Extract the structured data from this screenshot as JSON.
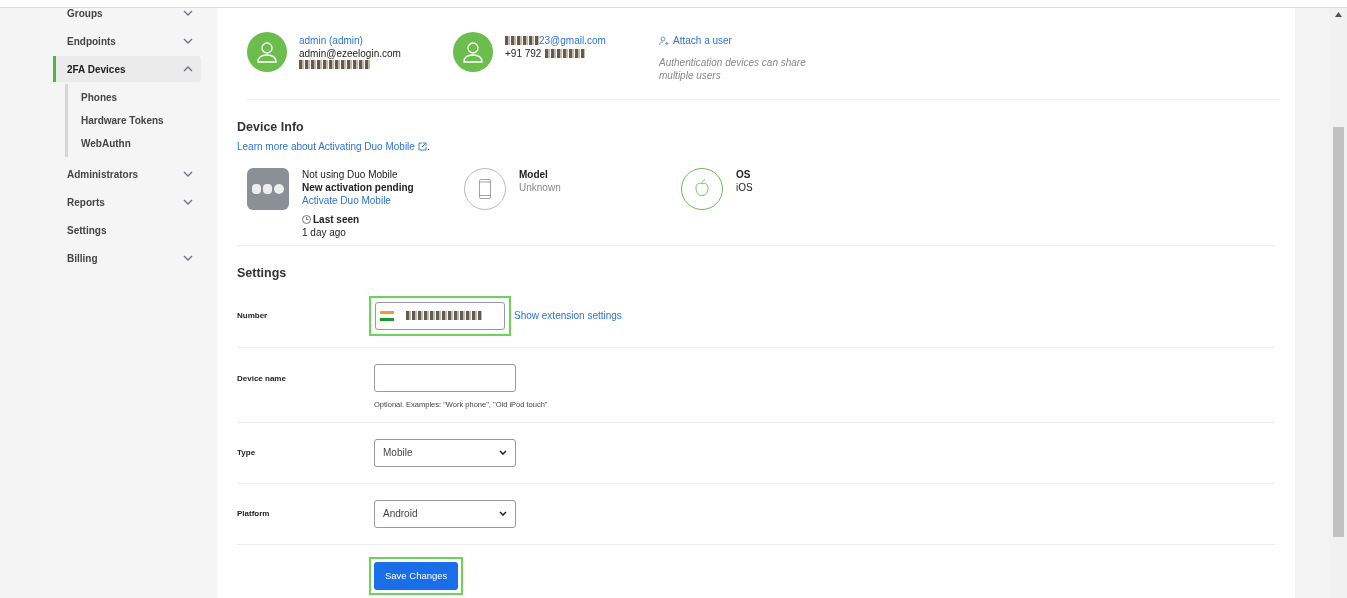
{
  "sidebar": {
    "items": [
      {
        "label": "Groups",
        "expandable": true,
        "expanded": false,
        "selected": false
      },
      {
        "label": "Endpoints",
        "expandable": true,
        "expanded": false,
        "selected": false
      },
      {
        "label": "2FA Devices",
        "expandable": true,
        "expanded": true,
        "selected": true,
        "children": [
          {
            "label": "Phones"
          },
          {
            "label": "Hardware Tokens"
          },
          {
            "label": "WebAuthn"
          }
        ]
      },
      {
        "label": "Administrators",
        "expandable": true,
        "expanded": false,
        "selected": false
      },
      {
        "label": "Reports",
        "expandable": true,
        "expanded": false,
        "selected": false
      },
      {
        "label": "Settings",
        "expandable": false,
        "selected": false
      },
      {
        "label": "Billing",
        "expandable": true,
        "expanded": false,
        "selected": false
      }
    ]
  },
  "users": [
    {
      "name": "admin (admin)",
      "email": "admin@ezeelogin.com"
    },
    {
      "email_visible": "23@gmail.com",
      "phone_visible": "+91 792"
    }
  ],
  "attach": {
    "label": "Attach a user",
    "note": "Authentication devices can share multiple users"
  },
  "device_info": {
    "title": "Device Info",
    "learn_more": "Learn more about Activating Duo Mobile",
    "learn_more_end": ".",
    "duo": {
      "line1": "Not using Duo Mobile",
      "line2": "New activation pending",
      "link": "Activate Duo Mobile",
      "last_seen_label": "Last seen",
      "last_seen": "1 day ago"
    },
    "model": {
      "label": "Model",
      "value": "Unknown"
    },
    "os": {
      "label": "OS",
      "value": "iOS"
    }
  },
  "settings": {
    "title": "Settings",
    "rows": [
      {
        "kind": "phone",
        "label": "Number",
        "link": "Show extension settings",
        "highlighted": true
      },
      {
        "kind": "text",
        "label": "Device name",
        "value": "",
        "hint": "Optional. Examples: \"Work phone\", \"Old iPod touch\""
      },
      {
        "kind": "select",
        "label": "Type",
        "value": "Mobile"
      },
      {
        "kind": "select",
        "label": "Platform",
        "value": "Android"
      }
    ],
    "save": {
      "label": "Save Changes",
      "highlighted": true
    }
  }
}
